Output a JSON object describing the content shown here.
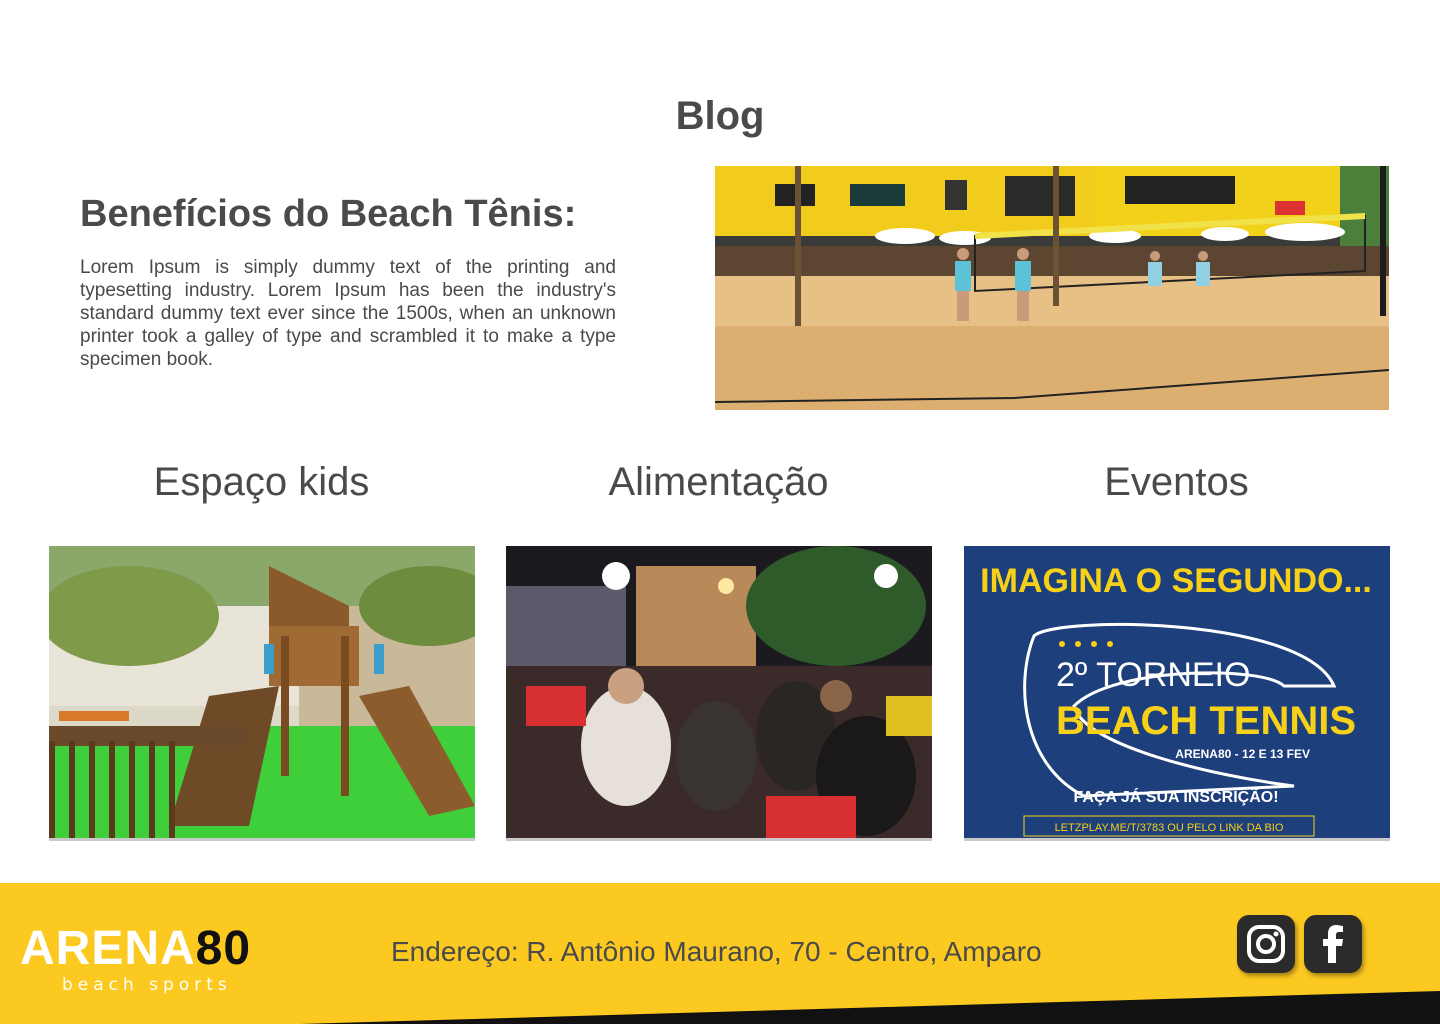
{
  "blog": {
    "title": "Blog"
  },
  "article": {
    "title": "Benefícios do Beach Tênis:",
    "body": "Lorem Ipsum is simply dummy text of the printing and typesetting industry. Lorem Ipsum has been the industry's standard dummy text ever since the 1500s, when an unknown printer took a galley of type and scrambled it to make a type specimen book."
  },
  "categories": [
    {
      "title": "Espaço kids"
    },
    {
      "title": "Alimentação"
    },
    {
      "title": "Eventos",
      "poster": {
        "headline": "IMAGINA O SEGUNDO...",
        "line1": "2º TORNEIO",
        "line2": "BEACH TENNIS",
        "details": "ARENA80 - 12 E 13 FEV",
        "cta": "FAÇA JÁ SUA INSCRIÇÃO!",
        "link": "LETZPLAY.ME/T/3783 OU PELO LINK DA BIO"
      }
    }
  ],
  "footer": {
    "logo_part1": "ARENA",
    "logo_part2": "80",
    "logo_sub": "beach sports",
    "address": "Endereço: R. Antônio Maurano, 70 - Centro, Amparo",
    "social": [
      "instagram-icon",
      "facebook-icon"
    ]
  },
  "colors": {
    "footer_bg": "#fbc91f",
    "text": "#4a4a4a",
    "poster_bg": "#1d3f7c",
    "poster_yellow": "#f7d117"
  }
}
